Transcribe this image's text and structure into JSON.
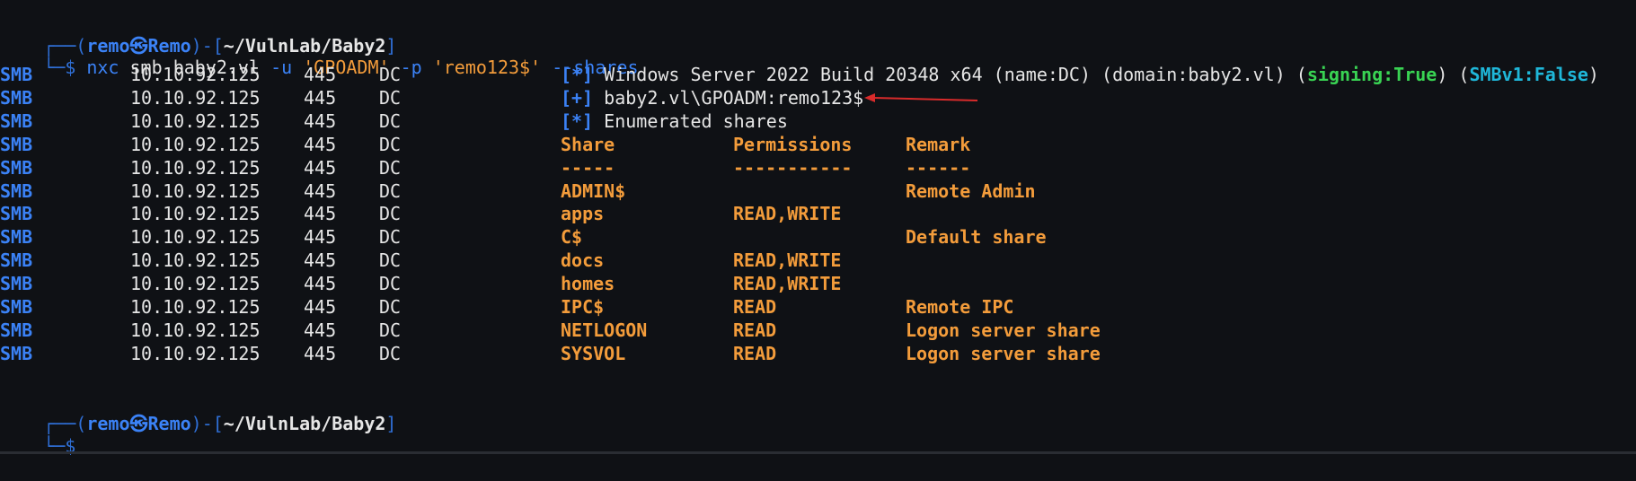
{
  "prompt1": {
    "corner_top": "┌──(",
    "user": "remo㉿Remo",
    "mid": ")-[",
    "path": "~/VulnLab/Baby2",
    "end": "]",
    "corner_bottom": "└─$ "
  },
  "command": {
    "bin": "nxc",
    "proto": "smb",
    "target": "baby2.vl",
    "flag_u": "-u",
    "user": "'GPOADM'",
    "flag_p": "-p",
    "pass": "'remo123$'",
    "flag_shares": "--shares"
  },
  "smb_rows": [
    {
      "proto": "SMB",
      "ip": "10.10.92.125",
      "port": "445",
      "host": "DC",
      "marker": "[*]",
      "msg": "Windows Server 2022 Build 20348 x64 (name:DC) (domain:baby2.vl) (",
      "msg_sign": "signing:True",
      "msg_mid": ") (",
      "msg_smb": "SMBv1:False",
      "msg_end": ")"
    },
    {
      "proto": "SMB",
      "ip": "10.10.92.125",
      "port": "445",
      "host": "DC",
      "marker": "[+]",
      "msg": "baby2.vl\\GPOADM:remo123$"
    },
    {
      "proto": "SMB",
      "ip": "10.10.92.125",
      "port": "445",
      "host": "DC",
      "marker": "[*]",
      "msg": "Enumerated shares"
    }
  ],
  "shares_table": {
    "headers": [
      "Share",
      "Permissions",
      "Remark"
    ],
    "dashes": [
      "-----",
      "-----------",
      "------"
    ],
    "rows": [
      [
        "ADMIN$",
        "",
        "Remote Admin"
      ],
      [
        "apps",
        "READ,WRITE",
        ""
      ],
      [
        "C$",
        "",
        "Default share"
      ],
      [
        "docs",
        "READ,WRITE",
        ""
      ],
      [
        "homes",
        "READ,WRITE",
        ""
      ],
      [
        "IPC$",
        "READ",
        "Remote IPC"
      ],
      [
        "NETLOGON",
        "READ",
        "Logon server share"
      ],
      [
        "SYSVOL",
        "READ",
        "Logon server share"
      ]
    ],
    "row_prefix": {
      "proto": "SMB",
      "ip": "10.10.92.125",
      "port": "445",
      "host": "DC"
    }
  },
  "prompt2": {
    "corner_top": "┌──(",
    "user": "remo㉿Remo",
    "mid": ")-[",
    "path": "~/VulnLab/Baby2",
    "end": "]",
    "corner_bottom": "└─$"
  },
  "colors": {
    "background": "#0f1115",
    "blue": "#3b82f6",
    "orange": "#f39c3b",
    "cyan": "#1fb7d9",
    "green": "#39d353",
    "arrow_red": "#d92b2b"
  }
}
